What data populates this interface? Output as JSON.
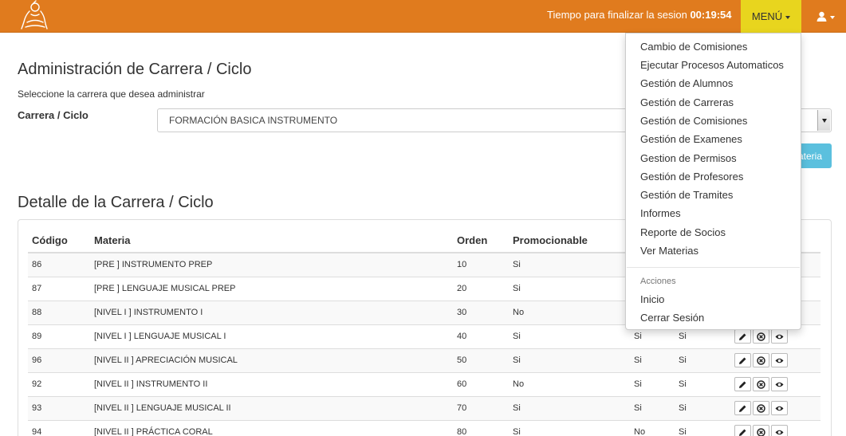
{
  "navbar": {
    "session_label": "Tiempo para finalizar la sesion",
    "session_time": "00:19:54",
    "menu_label": "MENÚ",
    "accent": "#e07b1e",
    "menu_bg": "#e8d51e",
    "logo_icon": "musician-logo",
    "user_icon": "user-icon"
  },
  "page": {
    "title": "Administración de Carrera / Ciclo",
    "subtitle": "Seleccione la carrera que desea administrar",
    "field_label": "Carrera / Ciclo",
    "selected_career": "FORMACIÓN BASICA INSTRUMENTO",
    "add_button": "ateria",
    "add_button_color": "#5bc0de"
  },
  "detail": {
    "title": "Detalle de la Carrera / Ciclo",
    "columns": [
      "Código",
      "Materia",
      "Orden",
      "Promocionable"
    ],
    "rows": [
      {
        "code": "86",
        "materia": "[PRE ] INSTRUMENTO PREP",
        "orden": "10",
        "prom": "Si",
        "a": "",
        "b": ""
      },
      {
        "code": "87",
        "materia": "[PRE ] LENGUAJE MUSICAL PREP",
        "orden": "20",
        "prom": "Si",
        "a": "",
        "b": ""
      },
      {
        "code": "88",
        "materia": "[NIVEL I ] INSTRUMENTO I",
        "orden": "30",
        "prom": "No",
        "a": "",
        "b": ""
      },
      {
        "code": "89",
        "materia": "[NIVEL I ] LENGUAJE MUSICAL I",
        "orden": "40",
        "prom": "Si",
        "a": "Si",
        "b": "Si"
      },
      {
        "code": "96",
        "materia": "[NIVEL II ] APRECIACIÓN MUSICAL",
        "orden": "50",
        "prom": "Si",
        "a": "Si",
        "b": "Si"
      },
      {
        "code": "92",
        "materia": "[NIVEL II ] INSTRUMENTO II",
        "orden": "60",
        "prom": "No",
        "a": "Si",
        "b": "Si"
      },
      {
        "code": "93",
        "materia": "[NIVEL II ] LENGUAJE MUSICAL II",
        "orden": "70",
        "prom": "Si",
        "a": "Si",
        "b": "Si"
      },
      {
        "code": "94",
        "materia": "[NIVEL II ] PRÁCTICA CORAL",
        "orden": "80",
        "prom": "Si",
        "a": "No",
        "b": "Si"
      }
    ]
  },
  "menu": {
    "items": [
      "Cambio de Comisiones",
      "Ejecutar Procesos Automaticos",
      "Gestión de Alumnos",
      "Gestión de Carreras",
      "Gestión de Comisiones",
      "Gestión de Examenes",
      "Gestion de Permisos",
      "Gestión de Profesores",
      "Gestión de Tramites",
      "Informes",
      "Reporte de Socios",
      "Ver Materias"
    ],
    "section_header": "Acciones",
    "actions": [
      "Inicio",
      "Cerrar Sesión"
    ]
  }
}
